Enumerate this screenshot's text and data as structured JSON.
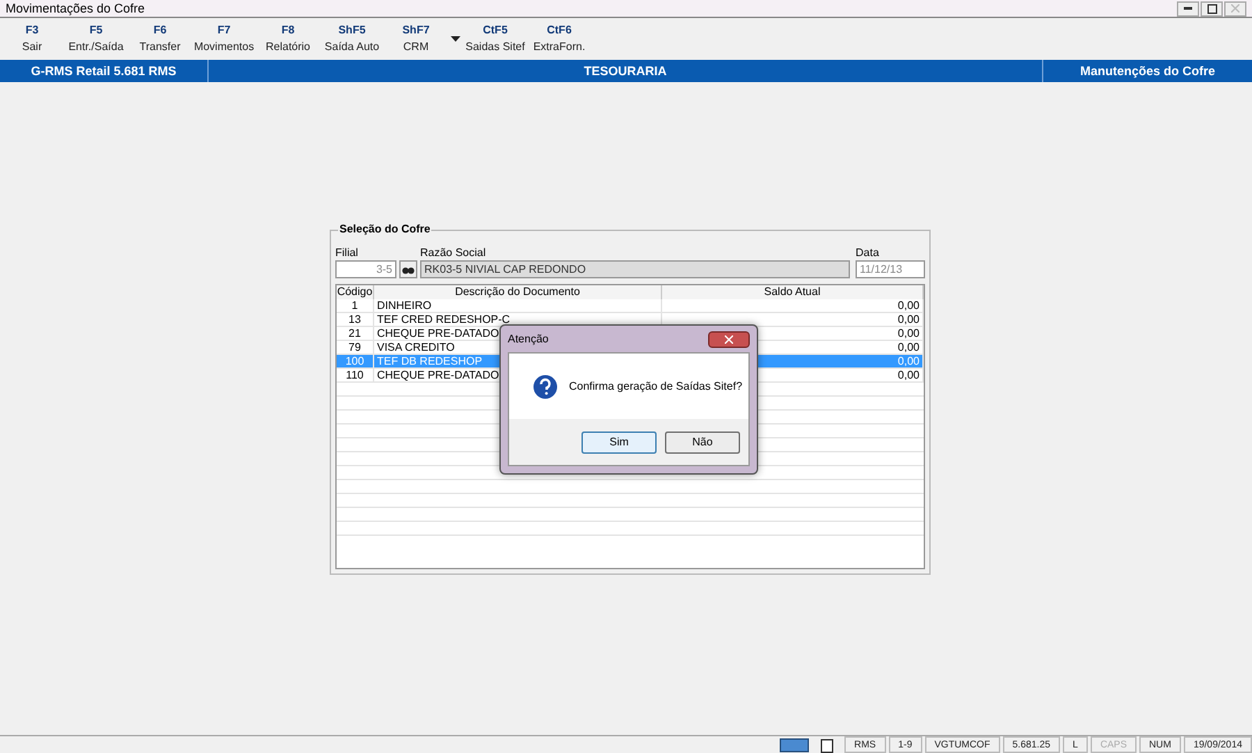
{
  "window": {
    "title": "Movimentações do Cofre"
  },
  "toolbar": [
    {
      "key": "F3",
      "label": "Sair"
    },
    {
      "key": "F5",
      "label": "Entr./Saída"
    },
    {
      "key": "F6",
      "label": "Transfer"
    },
    {
      "key": "F7",
      "label": "Movimentos"
    },
    {
      "key": "F8",
      "label": "Relatório"
    },
    {
      "key": "ShF5",
      "label": "Saída Auto"
    },
    {
      "key": "ShF7",
      "label": "CRM",
      "dropdown": true
    },
    {
      "key": "CtF5",
      "label": "Saidas Sitef"
    },
    {
      "key": "CtF6",
      "label": "ExtraForn."
    }
  ],
  "header_bar": {
    "left": "G-RMS Retail 5.681 RMS",
    "center": "TESOURARIA",
    "right": "Manutenções do Cofre"
  },
  "panel": {
    "title": "Seleção do Cofre",
    "filial": {
      "label": "Filial",
      "value": "3-5",
      "disabled": true
    },
    "razao": {
      "label": "Razão Social",
      "value": "RK03-5 NIVIAL CAP REDONDO"
    },
    "data": {
      "label": "Data",
      "value": "11/12/13",
      "disabled": true
    },
    "table": {
      "columns": [
        "Código",
        "Descrição do Documento",
        "Saldo Atual"
      ],
      "rows": [
        {
          "code": "1",
          "description": "DINHEIRO",
          "balance": "0,00",
          "selected": false
        },
        {
          "code": "13",
          "description": "TEF CRED REDESHOP-C",
          "balance": "0,00",
          "selected": false
        },
        {
          "code": "21",
          "description": "CHEQUE PRE-DATADO",
          "balance": "0,00",
          "selected": false
        },
        {
          "code": "79",
          "description": "VISA CREDITO",
          "balance": "0,00",
          "selected": false
        },
        {
          "code": "100",
          "description": "TEF DB REDESHOP",
          "balance": "0,00",
          "selected": true
        },
        {
          "code": "110",
          "description": "CHEQUE PRE-DATADO",
          "balance": "0,00",
          "selected": false
        }
      ]
    }
  },
  "dialog": {
    "title": "Atenção",
    "message": "Confirma geração de Saídas Sitef?",
    "buttons": [
      {
        "label": "Sim",
        "selected": true
      },
      {
        "label": "Não",
        "selected": false
      }
    ]
  },
  "status_bar": [
    {
      "text": "RMS",
      "on": true
    },
    {
      "text": "1-9",
      "on": true
    },
    {
      "text": "VGTUMCOF",
      "on": true
    },
    {
      "text": "5.681.25",
      "on": true
    },
    {
      "text": "L",
      "on": true
    },
    {
      "text": "CAPS",
      "on": false
    },
    {
      "text": "NUM",
      "on": true
    },
    {
      "text": "19/09/2014",
      "on": true
    }
  ]
}
